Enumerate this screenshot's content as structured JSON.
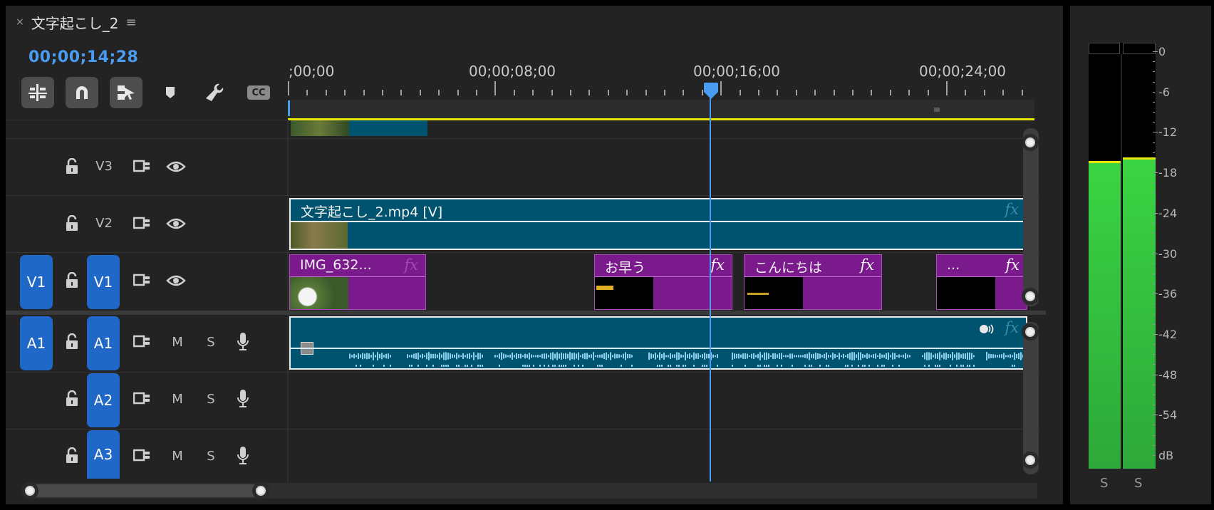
{
  "panel": {
    "close_label": "×",
    "title": "文字起こし_2",
    "menu_label": "≡"
  },
  "timecode": "00;00;14;28",
  "toolbar": {
    "tools": [
      "insert-sequence-nest-icon",
      "snap-magnet-icon",
      "linked-selection-icon",
      "add-marker-icon",
      "timeline-settings-wrench-icon",
      "captions-cc-icon"
    ],
    "cc_label": "CC"
  },
  "ruler": {
    "labels": [
      ";00;00",
      "00;00;08;00",
      "00;00;16;00",
      "00;00;24;00"
    ]
  },
  "tracks": {
    "v3": {
      "name": "V3"
    },
    "v2": {
      "name": "V2"
    },
    "v1": {
      "source": "V1",
      "name": "V1"
    },
    "a1": {
      "source": "A1",
      "name": "A1",
      "mute": "M",
      "solo": "S"
    },
    "a2": {
      "name": "A2",
      "mute": "M",
      "solo": "S"
    },
    "a3": {
      "name": "A3",
      "mute": "M",
      "solo": "S"
    }
  },
  "clips": {
    "v2_main": {
      "label": "文字起こし_2.mp4 [V]",
      "fx": "fx"
    },
    "v1_img": {
      "label": "IMG_632...",
      "fx": "fx"
    },
    "v1_ohayou": {
      "label": "お早う",
      "fx": "fx"
    },
    "v1_konnichiwa": {
      "label": "こんにちは",
      "fx": "fx"
    },
    "v1_more": {
      "label": "...",
      "fx": "fx"
    },
    "a1_main": {
      "fx": "fx"
    }
  },
  "meters": {
    "db_scale": [
      "0",
      "-6",
      "-12",
      "-18",
      "-24",
      "-30",
      "-36",
      "-42",
      "-48",
      "-54",
      "dB"
    ],
    "solo_labels": [
      "S",
      "S"
    ],
    "channel_levels_db": [
      -16.5,
      -16
    ]
  },
  "colors": {
    "playhead": "#4a9cf0",
    "video_clip": "#00536f",
    "graphic_clip": "#7b1a8c",
    "track_target": "#1f68c8",
    "meter_green": "#3ad443",
    "work_area": "#e6e600"
  }
}
